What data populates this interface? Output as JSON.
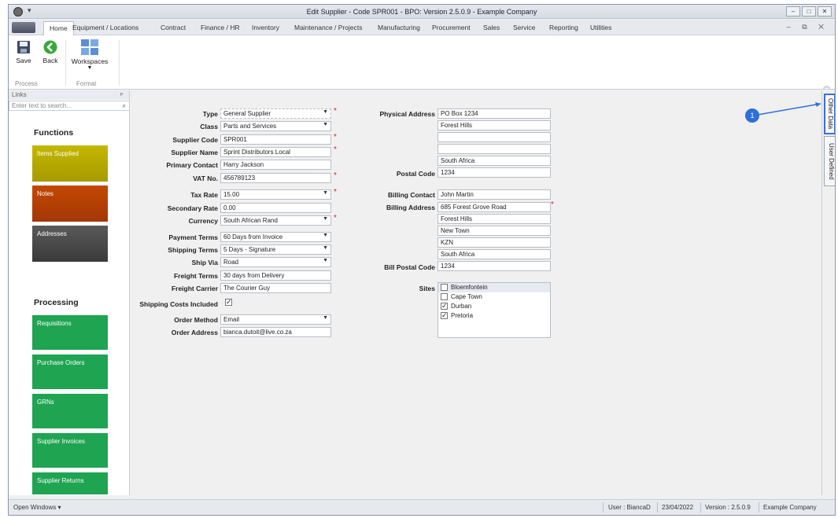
{
  "window": {
    "title": "Edit Supplier - Code SPR001 - BPO: Version 2.5.0.9 - Example Company",
    "controls": [
      "–",
      "□",
      "✕"
    ],
    "mdi_controls": "– ⧉ ✕",
    "quick_access": "▾"
  },
  "tabs": [
    "Home",
    "Equipment / Locations",
    "Contract",
    "Finance / HR",
    "Inventory",
    "Maintenance / Projects",
    "Manufacturing",
    "Procurement",
    "Sales",
    "Service",
    "Reporting",
    "Utilities"
  ],
  "ribbon": {
    "save": "Save",
    "back": "Back",
    "workspaces": "Workspaces",
    "group_process": "Process",
    "group_format": "Format"
  },
  "links": {
    "header": "Links",
    "pin": "ᵖ",
    "search_placeholder": "Enter text to search...",
    "functions_title": "Functions",
    "functions": [
      {
        "label": "Items Supplied",
        "color": "#b5a800"
      },
      {
        "label": "Notes",
        "color": "#b13e08"
      },
      {
        "label": "Addresses",
        "color": "#4a4a4a"
      }
    ],
    "processing_title": "Processing",
    "processing": [
      "Requisitions",
      "Purchase Orders",
      "GRNs",
      "Supplier Invoices",
      "Supplier Returns"
    ]
  },
  "form": {
    "type": {
      "label": "Type",
      "value": "General Supplier"
    },
    "class": {
      "label": "Class",
      "value": "Parts and Services"
    },
    "supplier_code": {
      "label": "Supplier Code",
      "value": "SPR001"
    },
    "supplier_name": {
      "label": "Supplier Name",
      "value": "Sprint Distributors Local"
    },
    "primary_contact": {
      "label": "Primary Contact",
      "value": "Harry Jackson"
    },
    "vat_no": {
      "label": "VAT No.",
      "value": "456789123"
    },
    "tax_rate": {
      "label": "Tax Rate",
      "value": "15.00"
    },
    "secondary_rate": {
      "label": "Secondary Rate",
      "value": "0.00"
    },
    "currency": {
      "label": "Currency",
      "value": "South African Rand"
    },
    "payment_terms": {
      "label": "Payment Terms",
      "value": "60 Days from Invoice"
    },
    "shipping_terms": {
      "label": "Shipping Terms",
      "value": "5 Days - Signature"
    },
    "ship_via": {
      "label": "Ship Via",
      "value": "Road"
    },
    "freight_terms": {
      "label": "Freight Terms",
      "value": "30 days from Delivery"
    },
    "freight_carrier": {
      "label": "Freight Carrier",
      "value": "The Courier Guy"
    },
    "shipping_costs_included": {
      "label": "Shipping Costs Included",
      "checked": true
    },
    "order_method": {
      "label": "Order Method",
      "value": "Email"
    },
    "order_address": {
      "label": "Order Address",
      "value": "bianca.dutoit@live.co.za"
    },
    "physical_address": {
      "label": "Physical Address",
      "lines": [
        "PO Box 1234",
        "Forest Hills",
        "",
        "",
        "South Africa"
      ]
    },
    "postal_code": {
      "label": "Postal Code",
      "value": "1234"
    },
    "billing_contact": {
      "label": "Billing Contact",
      "value": "John Martin"
    },
    "billing_address": {
      "label": "Billing Address",
      "lines": [
        "685 Forest Grove Road",
        "Forest Hills",
        "New Town",
        "KZN",
        "South Africa"
      ]
    },
    "bill_postal_code": {
      "label": "Bill Postal Code",
      "value": "1234"
    },
    "sites": {
      "label": "Sites",
      "items": [
        {
          "name": "Bloemfontein",
          "checked": false
        },
        {
          "name": "Cape Town",
          "checked": false
        },
        {
          "name": "Durban",
          "checked": true
        },
        {
          "name": "Pretoria",
          "checked": true
        }
      ]
    },
    "required_mark": "*",
    "check_glyph": "✓"
  },
  "side_tabs": [
    "Other Data",
    "User Defined"
  ],
  "callout": "1",
  "status": {
    "open_windows": "Open Windows ▾",
    "user": "User : BiancaD",
    "date": "23/04/2022",
    "version": "Version : 2.5.0.9",
    "company": "Example Company"
  }
}
